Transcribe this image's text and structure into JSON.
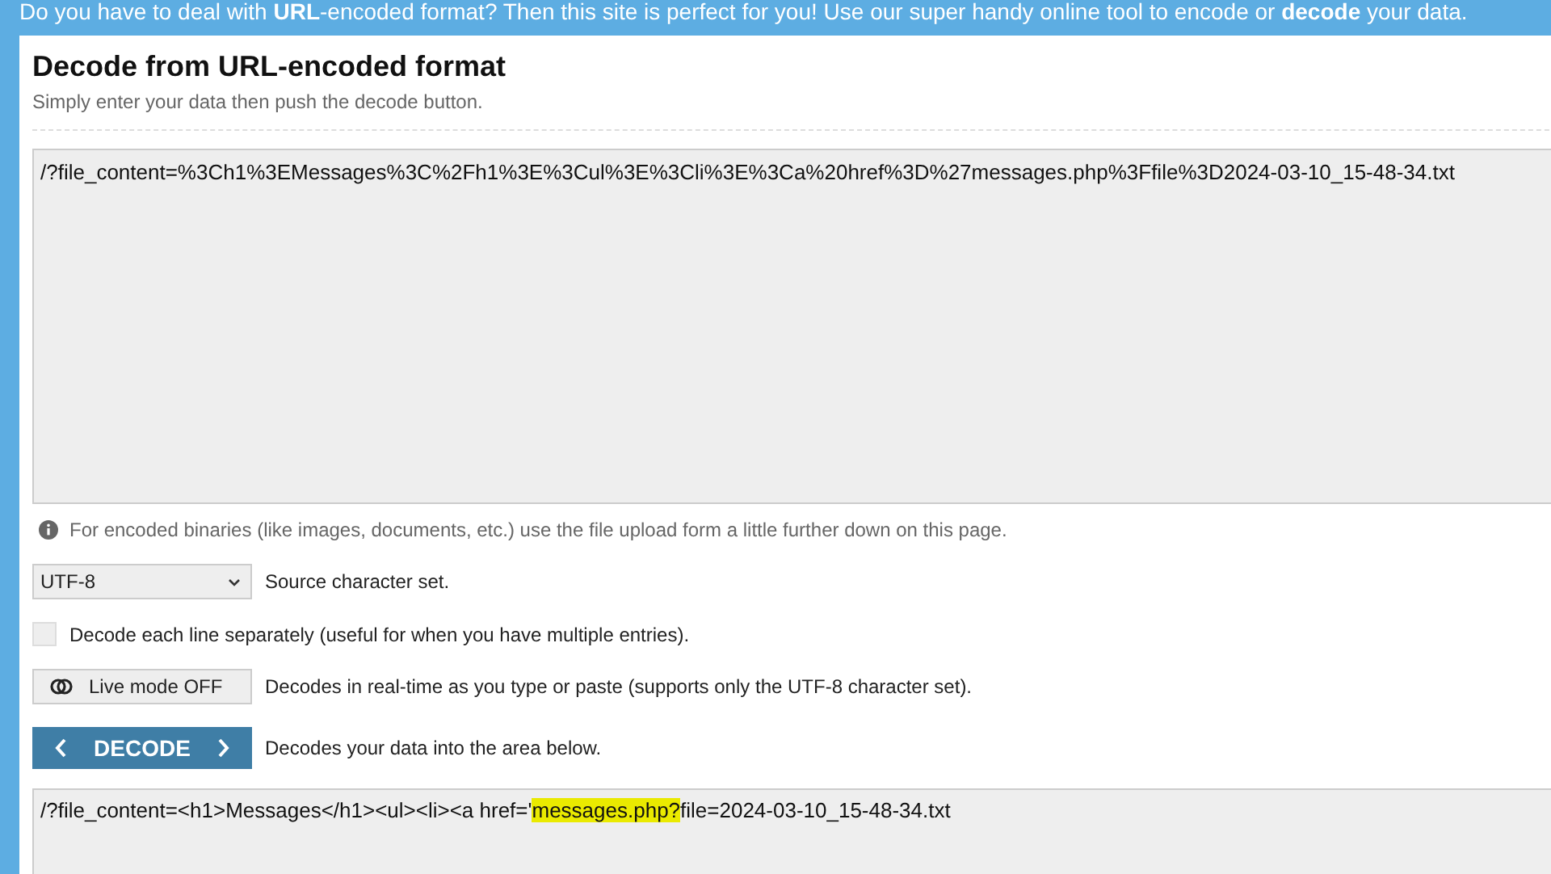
{
  "banner": {
    "text": "Do you have to deal with **URL**-encoded format? Then this site is perfect for you! Use our super handy online tool to encode or **decode** your data."
  },
  "heading": {
    "title": "Decode from URL-encoded format",
    "subtitle": "Simply enter your data then push the decode button."
  },
  "input": {
    "value": "/?file_content=%3Ch1%3EMessages%3C%2Fh1%3E%3Cul%3E%3Cli%3E%3Ca%20href%3D%27messages.php%3Ffile%3D2024-03-10_15-48-34.txt"
  },
  "info_note": "For encoded binaries (like images, documents, etc.) use the file upload form a little further down on this page.",
  "charset": {
    "value": "UTF-8",
    "label": "Source character set."
  },
  "line_by_line": {
    "checked": false,
    "label": "Decode each line separately (useful for when you have multiple entries)."
  },
  "live_mode": {
    "label": "Live mode OFF",
    "on": false,
    "description": "Decodes in real-time as you type or paste (supports only the UTF-8 character set)."
  },
  "decode": {
    "label": "DECODE",
    "description": "Decodes your data into the area below."
  },
  "output": {
    "segments": [
      {
        "text": "/?file_content=<h1>Messages</h1><ul><li><a href='",
        "highlighted": false
      },
      {
        "text": "messages.php?",
        "highlighted": true
      },
      {
        "text": "file=2024-03-10_15-48-34.txt",
        "highlighted": false
      }
    ]
  }
}
